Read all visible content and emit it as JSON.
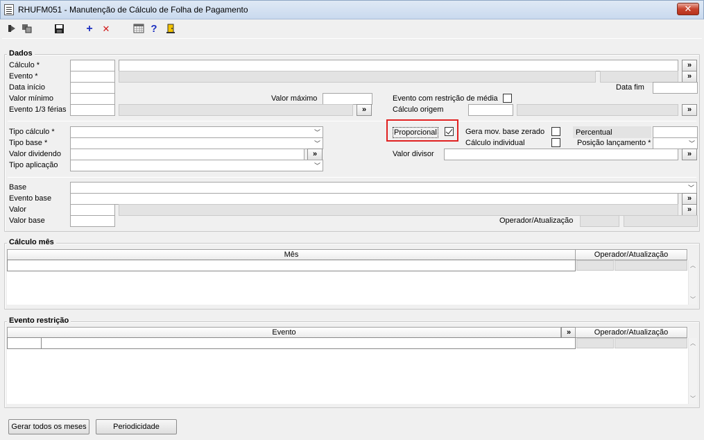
{
  "window": {
    "title": "RHUFM051 - Manutenção de Cálculo de Folha de Pagamento",
    "close": "✕"
  },
  "toolbar": {
    "icons": [
      "nav-first-icon",
      "copy-icon",
      "save-icon",
      "add-icon",
      "delete-icon",
      "calendar-icon",
      "help-icon",
      "exit-icon"
    ],
    "add_glyph": "+",
    "delete_glyph": "✕",
    "help_glyph": "?"
  },
  "dados": {
    "legend": "Dados",
    "calculo": "Cálculo *",
    "evento": "Evento *",
    "data_inicio": "Data início",
    "data_fim": "Data fim",
    "valor_minimo": "Valor mínimo",
    "valor_maximo": "Valor máximo",
    "evento_ferias": "Evento 1/3 férias",
    "evento_restricao_media": "Evento com restrição de média",
    "calculo_origem": "Cálculo origem",
    "tipo_calculo": "Tipo cálculo *",
    "tipo_base": "Tipo base *",
    "valor_dividendo": "Valor dividendo",
    "tipo_aplicacao": "Tipo aplicação",
    "proporcional": "Proporcional",
    "proporcional_checked": true,
    "gera_mov": "Gera mov. base zerado",
    "calculo_individual": "Cálculo individual",
    "percentual": "Percentual",
    "posicao_lancamento": "Posição lançamento *",
    "valor_divisor": "Valor divisor",
    "base": "Base",
    "evento_base": "Evento base",
    "valor": "Valor",
    "valor_base": "Valor base",
    "operador_atualizacao": "Operador/Atualização",
    "ellipsis": "»",
    "chevron": "﹀"
  },
  "calculo_mes": {
    "legend": "Cálculo mês",
    "col_mes": "Mês",
    "col_operador": "Operador/Atualização"
  },
  "evento_restricao": {
    "legend": "Evento restrição",
    "col_evento": "Evento",
    "col_operador": "Operador/Atualização",
    "ellipsis": "»"
  },
  "buttons": {
    "gerar": "Gerar todos os meses",
    "periodicidade": "Periodicidade"
  },
  "colors": {
    "highlight": "#e02020",
    "titlebar": "#c9d9ee"
  }
}
